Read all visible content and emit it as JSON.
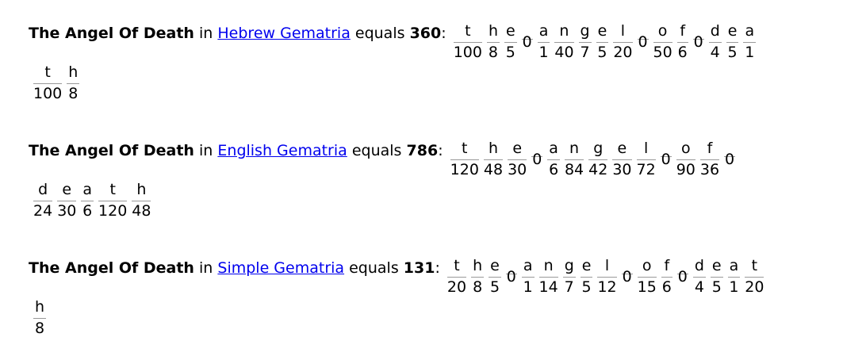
{
  "entries": [
    {
      "phrase": "The Angel Of Death",
      "in": "in",
      "cipher": "Hebrew Gematria",
      "equals": "equals",
      "total": "360",
      "colon": ":",
      "row1": [
        {
          "c": "t",
          "v": "100"
        },
        {
          "c": "h",
          "v": "8"
        },
        {
          "c": "e",
          "v": "5"
        },
        {
          "c": "",
          "v": "0"
        },
        {
          "c": "a",
          "v": "1"
        },
        {
          "c": "n",
          "v": "40"
        },
        {
          "c": "g",
          "v": "7"
        },
        {
          "c": "e",
          "v": "5"
        },
        {
          "c": "l",
          "v": "20"
        },
        {
          "c": "",
          "v": "0"
        },
        {
          "c": "o",
          "v": "50"
        },
        {
          "c": "f",
          "v": "6"
        },
        {
          "c": "",
          "v": "0"
        },
        {
          "c": "d",
          "v": "4"
        },
        {
          "c": "e",
          "v": "5"
        },
        {
          "c": "a",
          "v": "1"
        }
      ],
      "row2": [
        {
          "c": "t",
          "v": "100"
        },
        {
          "c": "h",
          "v": "8"
        }
      ]
    },
    {
      "phrase": "The Angel Of Death",
      "in": "in",
      "cipher": "English Gematria",
      "equals": "equals",
      "total": "786",
      "colon": ":",
      "row1": [
        {
          "c": "t",
          "v": "120"
        },
        {
          "c": "h",
          "v": "48"
        },
        {
          "c": "e",
          "v": "30"
        },
        {
          "c": "",
          "v": "0"
        },
        {
          "c": "a",
          "v": "6"
        },
        {
          "c": "n",
          "v": "84"
        },
        {
          "c": "g",
          "v": "42"
        },
        {
          "c": "e",
          "v": "30"
        },
        {
          "c": "l",
          "v": "72"
        },
        {
          "c": "",
          "v": "0"
        },
        {
          "c": "o",
          "v": "90"
        },
        {
          "c": "f",
          "v": "36"
        },
        {
          "c": "",
          "v": "0"
        }
      ],
      "row2": [
        {
          "c": "d",
          "v": "24"
        },
        {
          "c": "e",
          "v": "30"
        },
        {
          "c": "a",
          "v": "6"
        },
        {
          "c": "t",
          "v": "120"
        },
        {
          "c": "h",
          "v": "48"
        }
      ]
    },
    {
      "phrase": "The Angel Of Death",
      "in": "in",
      "cipher": "Simple Gematria",
      "equals": "equals",
      "total": "131",
      "colon": ":",
      "row1": [
        {
          "c": "t",
          "v": "20"
        },
        {
          "c": "h",
          "v": "8"
        },
        {
          "c": "e",
          "v": "5"
        },
        {
          "c": "",
          "v": "0"
        },
        {
          "c": "a",
          "v": "1"
        },
        {
          "c": "n",
          "v": "14"
        },
        {
          "c": "g",
          "v": "7"
        },
        {
          "c": "e",
          "v": "5"
        },
        {
          "c": "l",
          "v": "12"
        },
        {
          "c": "",
          "v": "0"
        },
        {
          "c": "o",
          "v": "15"
        },
        {
          "c": "f",
          "v": "6"
        },
        {
          "c": "",
          "v": "0"
        },
        {
          "c": "d",
          "v": "4"
        },
        {
          "c": "e",
          "v": "5"
        },
        {
          "c": "a",
          "v": "1"
        },
        {
          "c": "t",
          "v": "20"
        }
      ],
      "row2": [
        {
          "c": "h",
          "v": "8"
        }
      ]
    }
  ]
}
